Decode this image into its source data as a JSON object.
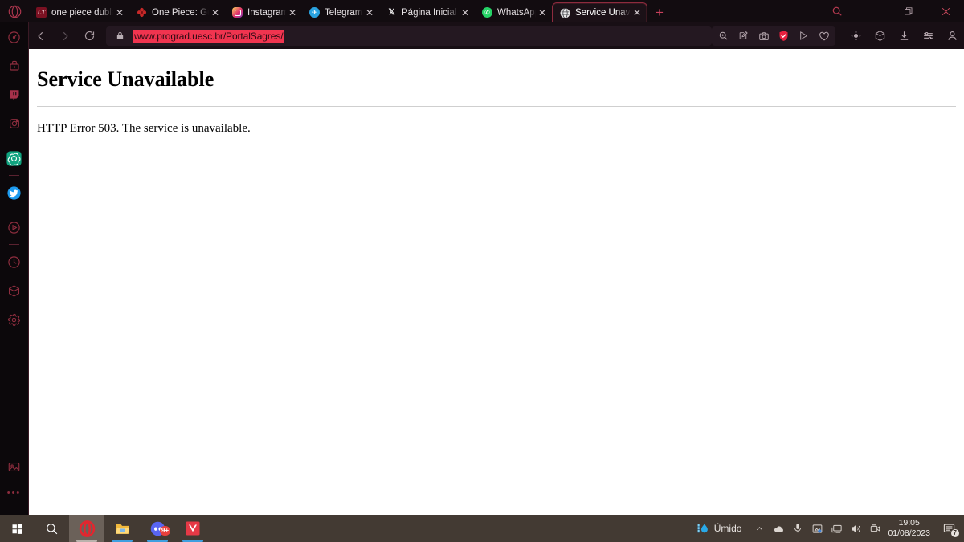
{
  "browser": {
    "name": "Opera",
    "tabs": [
      {
        "title": "one piece dublado",
        "icon": "lt-favicon",
        "active": false,
        "width": "first"
      },
      {
        "title": "One Piece: Guia de",
        "icon": "flower-favicon",
        "active": false,
        "width": "wide"
      },
      {
        "title": "Instagram",
        "icon": "instagram-favicon",
        "active": false,
        "width": "normal"
      },
      {
        "title": "Telegram Web",
        "icon": "telegram-favicon",
        "active": false,
        "width": "normal"
      },
      {
        "title": "Página Inicial / X",
        "icon": "x-twitter-favicon",
        "active": false,
        "width": "wide"
      },
      {
        "title": "WhatsApp",
        "icon": "whatsapp-favicon",
        "active": false,
        "width": "normal"
      },
      {
        "title": "Service Unavailable",
        "icon": "globe-favicon",
        "active": true,
        "width": "wide"
      }
    ],
    "new_tab_label": "+",
    "window_controls": {
      "search": "search-icon",
      "minimize": "minimize-icon",
      "maximize": "maximize-icon",
      "close": "close-icon"
    },
    "toolbar": {
      "back": "back-arrow-icon",
      "forward": "forward-arrow-icon",
      "reload": "reload-icon",
      "lock": "lock-icon",
      "url": "www.prograd.uesc.br/PortalSagres/",
      "url_selected": true,
      "right_icons": [
        "zoom-search-icon",
        "page-edit-icon",
        "snapshot-camera-icon",
        "adblock-shield-icon",
        "send-icon",
        "heart-favorite-icon",
        "crypto-wallet-icon",
        "opera-module-icon",
        "downloads-icon",
        "easy-setup-icon",
        "profile-icon"
      ]
    },
    "sidebar": {
      "items": [
        {
          "name": "speed-dial-icon",
          "color": "#8d2d3e"
        },
        {
          "name": "brush-messenger-icon",
          "color": "#8d2d3e"
        },
        {
          "name": "twitch-icon",
          "color": "#a5314a"
        },
        {
          "name": "instagram-icon",
          "color": "#8d2d3e"
        },
        {
          "name": "divider",
          "color": "#5a2230"
        },
        {
          "name": "chatgpt-icon",
          "color": "#10a37f"
        },
        {
          "name": "divider",
          "color": "#5a2230"
        },
        {
          "name": "twitter-icon",
          "color": "#1d9bf0"
        },
        {
          "name": "divider",
          "color": "#5a2230"
        },
        {
          "name": "player-icon",
          "color": "#8d2d3e"
        },
        {
          "name": "divider",
          "color": "#5a2230"
        },
        {
          "name": "history-clock-icon",
          "color": "#8d2d3e"
        },
        {
          "name": "package-cube-icon",
          "color": "#8d2d3e"
        },
        {
          "name": "settings-gear-icon",
          "color": "#8d2d3e"
        }
      ],
      "bottom_items": [
        {
          "name": "gallery-image-icon",
          "color": "#8d2d3e"
        },
        {
          "name": "more-dots-icon",
          "color": "#8d2d3e"
        }
      ],
      "more_dots": "•••"
    }
  },
  "page": {
    "title": "Service Unavailable",
    "message": "HTTP Error 503. The service is unavailable."
  },
  "taskbar": {
    "start": "windows-start-icon",
    "search": "search-icon",
    "apps": [
      {
        "name": "opera-taskbar-icon",
        "active": true,
        "running": true
      },
      {
        "name": "file-explorer-icon",
        "active": false,
        "running": true
      },
      {
        "name": "discord-icon",
        "active": false,
        "running": true,
        "badge": "9+"
      },
      {
        "name": "valorant-icon",
        "active": false,
        "running": true
      }
    ],
    "weather": {
      "icon": "water-drop-icon",
      "label": "Úmido"
    },
    "tray": [
      "chevron-up-icon",
      "onedrive-cloud-icon",
      "microphone-icon",
      "screen-capture-icon",
      "network-monitor-icon",
      "volume-speaker-icon",
      "webcam-icon"
    ],
    "clock": {
      "time": "19:05",
      "date": "01/08/2023"
    },
    "notifications": {
      "icon": "notification-icon",
      "count": "7"
    }
  },
  "colors": {
    "accent": "#c9415c",
    "url_highlight": "#f0344f",
    "sidebar_bg": "#0c080b",
    "toolbar_bg": "#180f15",
    "taskbar_bg": "#433a33"
  }
}
